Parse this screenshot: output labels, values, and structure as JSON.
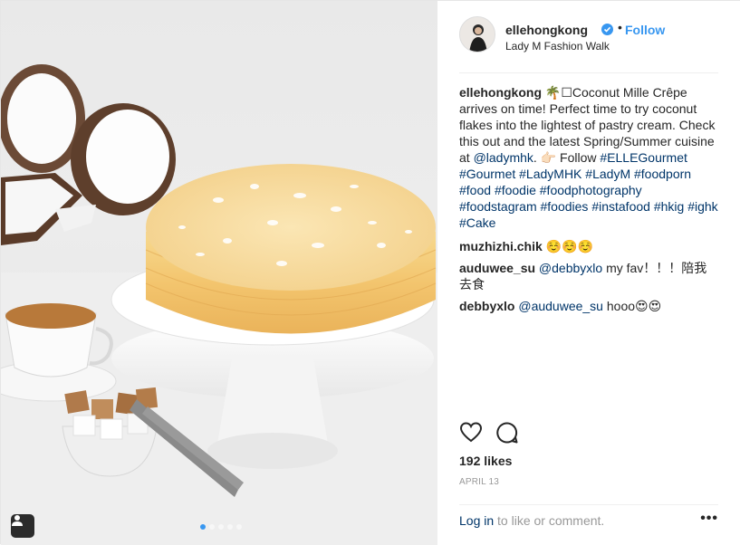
{
  "post": {
    "username": "ellehongkong",
    "follow_label": "Follow",
    "separator": "•",
    "location": "Lady M Fashion Walk",
    "caption": {
      "user": "ellehongkong",
      "text_1": "🌴☐Coconut Mille Crêpe arrives on time! Perfect time to try coconut flakes into the lightest of pastry cream. Check this out and the latest Spring/Summer cuisine at",
      "mention": "@ladymhk",
      "text_2": ". 👉🏻 Follow",
      "tags": [
        "#ELLEGourmet",
        "#Gourmet",
        "#LadyMHK",
        "#LadyM",
        "#foodporn",
        "#food",
        "#foodie",
        "#foodphotography",
        "#foodstagram",
        "#foodies",
        "#instafood",
        "#hkig",
        "#ighk",
        "#Cake"
      ]
    },
    "comments": [
      {
        "user": "muzhizhi.chik",
        "mention": "",
        "text": "☺️☺️☺️"
      },
      {
        "user": "auduwee_su",
        "mention": "@debbyxlo",
        "text": "my fav！！！陪我去食"
      },
      {
        "user": "debbyxlo",
        "mention": "@auduwee_su",
        "text": "hooo😍😍"
      }
    ],
    "likes": "192 likes",
    "date": "APRIL 13",
    "login_link": "Log in",
    "login_text": "to like or comment.",
    "more_label": "•••",
    "carousel": {
      "count": 5,
      "active": 0
    },
    "icons": [
      "heart-icon",
      "comment-icon",
      "verified-icon",
      "tag-person-icon",
      "more-icon"
    ],
    "colors": {
      "accent": "#3897f0",
      "link": "#003569",
      "muted": "#999999"
    }
  }
}
